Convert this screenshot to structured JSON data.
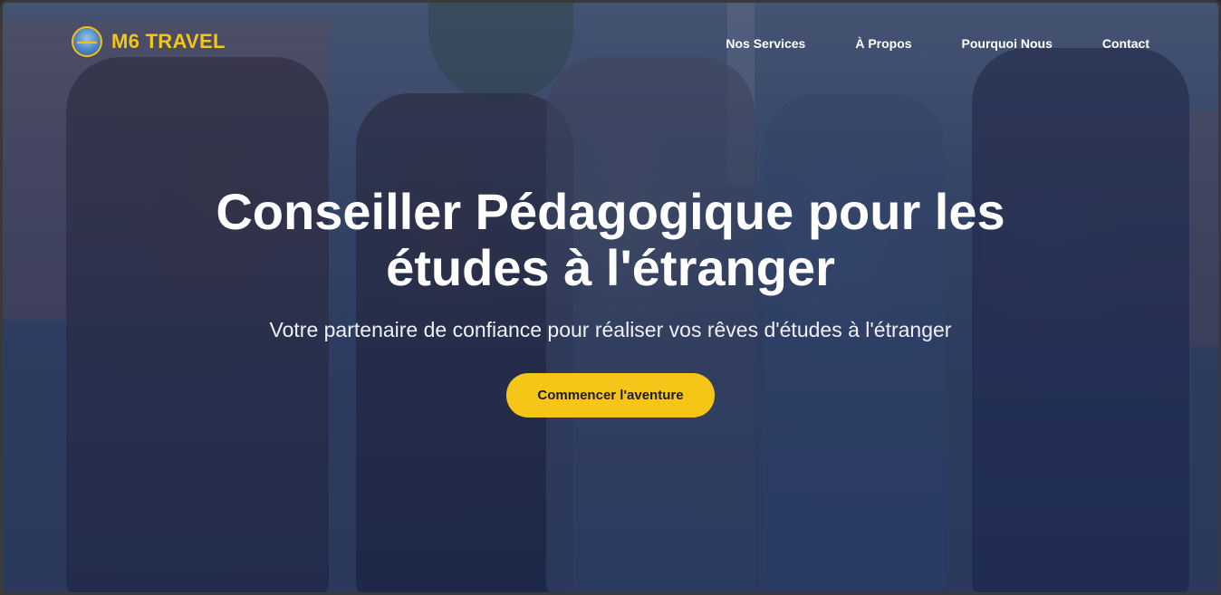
{
  "brand": {
    "name": "M6 TRAVEL",
    "logo_icon": "globe-airplane-icon",
    "accent_color": "#f5c518"
  },
  "nav": {
    "items": [
      {
        "label": "Nos Services"
      },
      {
        "label": "À Propos"
      },
      {
        "label": "Pourquoi Nous"
      },
      {
        "label": "Contact"
      }
    ]
  },
  "hero": {
    "title": "Conseiller Pédagogique pour les études à l'étranger",
    "subtitle": "Votre partenaire de confiance pour réaliser vos rêves d'études à l'étranger",
    "cta_label": "Commencer l'aventure",
    "overlay_color": "#19284f"
  }
}
